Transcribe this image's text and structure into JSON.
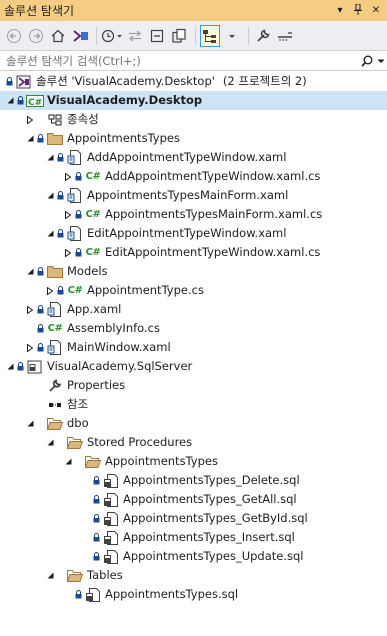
{
  "window": {
    "title": "솔루션 탐색기",
    "pin_glyph": "▾",
    "autohide_glyph": "📌",
    "close_glyph": "✕"
  },
  "search": {
    "placeholder": "솔루션 탐색기 검색(Ctrl+;)"
  },
  "tree": {
    "solution_label": "솔루션 'VisualAcademy.Desktop'",
    "solution_count": "(2 프로젝트의 2)",
    "items": [
      {
        "label": "VisualAcademy.Desktop"
      },
      {
        "label": "종속성"
      },
      {
        "label": "AppointmentsTypes"
      },
      {
        "label": "AddAppointmentTypeWindow.xaml"
      },
      {
        "label": "AddAppointmentTypeWindow.xaml.cs"
      },
      {
        "label": "AppointmentsTypesMainForm.xaml"
      },
      {
        "label": "AppointmentsTypesMainForm.xaml.cs"
      },
      {
        "label": "EditAppointmentTypeWindow.xaml"
      },
      {
        "label": "EditAppointmentTypeWindow.xaml.cs"
      },
      {
        "label": "Models"
      },
      {
        "label": "AppointmentType.cs"
      },
      {
        "label": "App.xaml"
      },
      {
        "label": "AssemblyInfo.cs"
      },
      {
        "label": "MainWindow.xaml"
      },
      {
        "label": "VisualAcademy.SqlServer"
      },
      {
        "label": "Properties"
      },
      {
        "label": "참조"
      },
      {
        "label": "dbo"
      },
      {
        "label": "Stored Procedures"
      },
      {
        "label": "AppointmentsTypes"
      },
      {
        "label": "AppointmentsTypes_Delete.sql"
      },
      {
        "label": "AppointmentsTypes_GetAll.sql"
      },
      {
        "label": "AppointmentsTypes_GetById.sql"
      },
      {
        "label": "AppointmentsTypes_Insert.sql"
      },
      {
        "label": "AppointmentsTypes_Update.sql"
      },
      {
        "label": "Tables"
      },
      {
        "label": "AppointmentsTypes.sql"
      }
    ]
  }
}
